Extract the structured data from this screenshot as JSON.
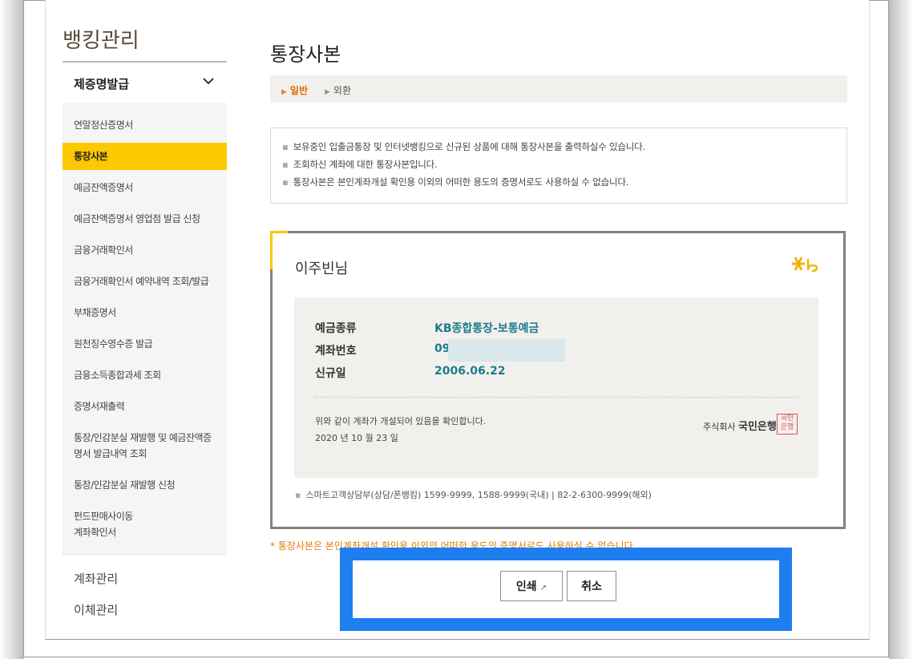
{
  "sidebar": {
    "title": "뱅킹관리",
    "group": "제증명발급",
    "items": [
      "연말정산증명서",
      "통장사본",
      "예금잔액증명서",
      "예금잔액증명서 영업점 발급 신청",
      "금융거래확인서",
      "금융거래확인서 예약내역 조회/발급",
      "부채증명서",
      "원천징수영수증 발급",
      "금융소득종합과세 조회",
      "증명서재출력",
      "통장/인감분실 재발행 및 예금잔액증",
      "명서 발급내역 조회",
      "통장/인감분실 재발행 신청",
      "펀드판매사이동",
      "계좌확인서"
    ],
    "other": [
      "계좌관리",
      "이체관리"
    ]
  },
  "main": {
    "title": "통장사본",
    "tabs": [
      "일반",
      "외환"
    ],
    "notices": [
      "보유중인 입출금통장 및 인터넷뱅킹으로 신규된 상품에 대해 통장사본을 출력하실수 있습니다.",
      "조회하신 계좌에 대한 통장사본입니다.",
      "통장사본은 본인계좌개설 확인용 이외의 어떠한 용도의 증명서로도 사용하실 수 없습니다."
    ]
  },
  "card": {
    "name": "이주빈님",
    "logo": "Kb",
    "labels": [
      "예금종류",
      "계좌번호",
      "신규일"
    ],
    "values": [
      "KB종합통장-보통예금",
      "09",
      "2006.06.22"
    ],
    "confirm": "위와 같이 계좌가 개설되어 있음을 확인합니다.",
    "date": "2020 년 10 월 23 일",
    "bank_prefix": "주식회사",
    "bank": "국민은행",
    "seal": "국민은행",
    "footer": "스마트고객상담부(상담/폰뱅킹) 1599-9999, 1588-9999(국내) | 82-2-6300-9999(해외)"
  },
  "warning": "* 통장사본은 본인계좌개설 확인용 이외의 어떠한 용도의 증명서로도 사용하실 수 없습니다.",
  "buttons": {
    "print": "인쇄",
    "cancel": "취소"
  },
  "colors": {
    "accent": "#fcc800",
    "highlight_border": "#1e7ef0",
    "value_text": "#1a7c8c"
  }
}
